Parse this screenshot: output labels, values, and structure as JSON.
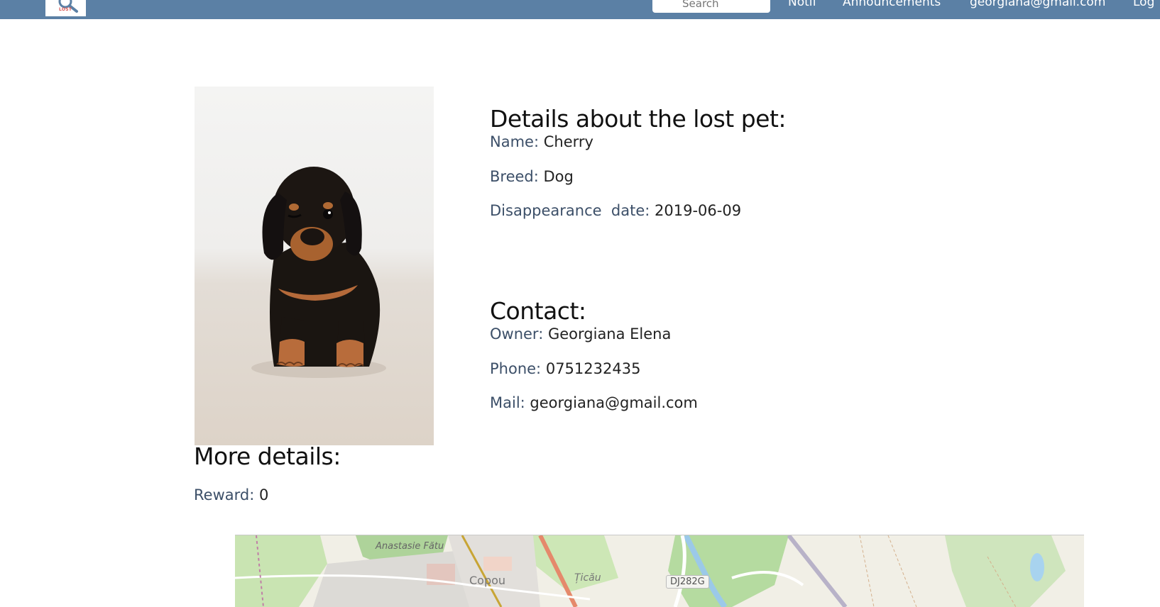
{
  "header": {
    "logo_text": "LOST",
    "search": {
      "placeholder": "Search",
      "value": ""
    },
    "nav": [
      "Notif",
      "Announcements",
      "georgiana@gmail.com",
      "Log"
    ]
  },
  "pet": {
    "title": "Details about the lost pet:",
    "name_label": "Name:",
    "name": "Cherry",
    "breed_label": "Breed:",
    "breed": "Dog",
    "date_label": "Disappearance  date:",
    "date": "2019-06-09"
  },
  "contact": {
    "title": "Contact:",
    "owner_label": "Owner:",
    "owner": "Georgiana Elena",
    "phone_label": "Phone:",
    "phone": "0751232435",
    "mail_label": "Mail:",
    "mail": "georgiana@gmail.com"
  },
  "more": {
    "title": "More details:",
    "reward_label": "Reward:",
    "reward": "0"
  },
  "map": {
    "labels": [
      "Anastasie Fătu",
      "Copou",
      "Țicău",
      "DJ282G"
    ]
  },
  "colors": {
    "header_bg": "#5b80a5",
    "label_color": "#3c4f68"
  }
}
